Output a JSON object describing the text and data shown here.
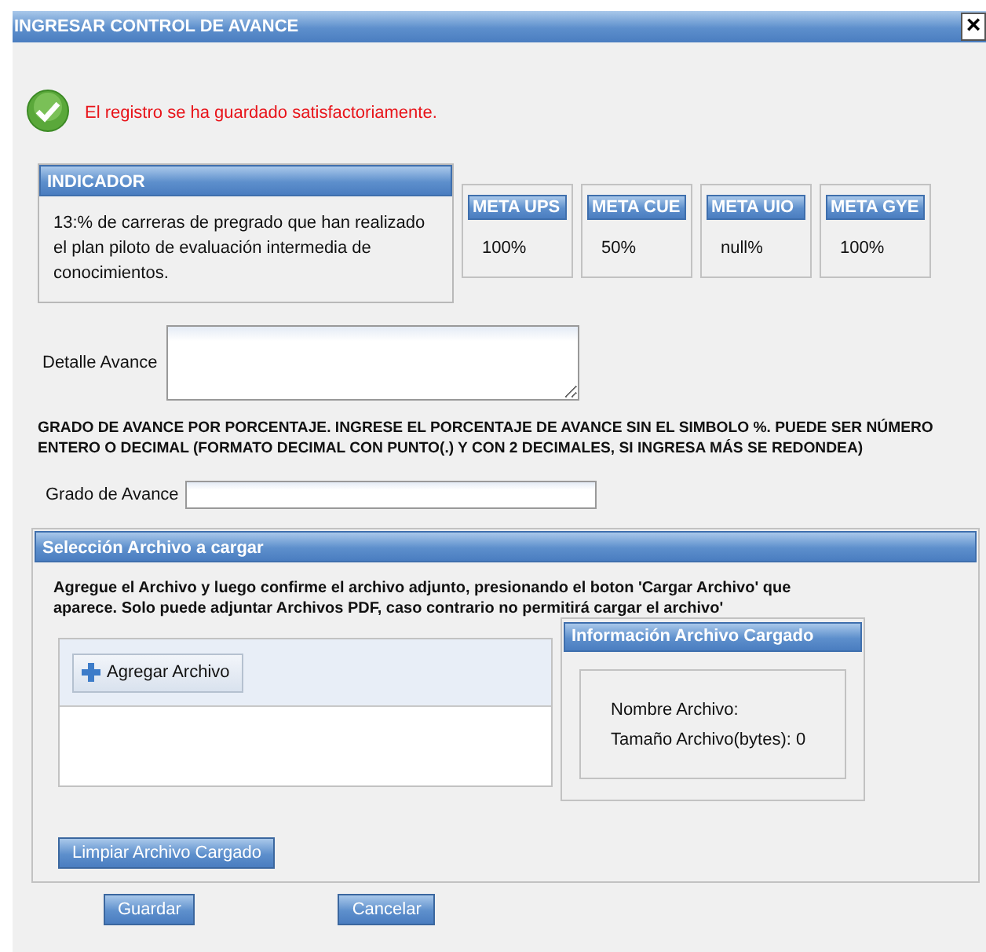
{
  "window": {
    "title": "INGRESAR CONTROL DE AVANCE",
    "close": "×"
  },
  "message": {
    "kind": "success",
    "text": "El registro se ha guardado satisfactoriamente."
  },
  "indicator": {
    "header": "INDICADOR",
    "text": "13:% de carreras de pregrado que han realizado el plan piloto de evaluación intermedia de conocimientos."
  },
  "metas": [
    {
      "header": "META UPS",
      "value": "100%"
    },
    {
      "header": "META CUE",
      "value": "50%"
    },
    {
      "header": "META UIO",
      "value": "null%"
    },
    {
      "header": "META GYE",
      "value": "100%"
    }
  ],
  "detalle": {
    "label": "Detalle Avance"
  },
  "instruction": "GRADO DE AVANCE POR PORCENTAJE. INGRESE EL PORCENTAJE DE AVANCE SIN EL SIMBOLO %. PUEDE SER NÚMERO ENTERO O DECIMAL (FORMATO DECIMAL CON PUNTO(.) Y CON 2 DECIMALES, SI INGRESA MÁS SE REDONDEA)",
  "grado": {
    "label": "Grado de Avance"
  },
  "upload": {
    "header": "Selección Archivo a cargar",
    "text": "Agregue el Archivo y luego confirme el archivo adjunto, presionando el boton 'Cargar Archivo' que aparece. Solo puede adjuntar Archivos PDF, caso contrario no permitirá cargar el archivo'",
    "add_button": "Agregar Archivo",
    "info_header": "Información Archivo Cargado",
    "file_name_label": "Nombre Archivo:",
    "file_size_label": "Tamaño Archivo(bytes):",
    "file_size": "0",
    "clear_button": "Limpiar Archivo Cargado"
  },
  "buttons": [
    "Guardar",
    "Cancelar"
  ]
}
